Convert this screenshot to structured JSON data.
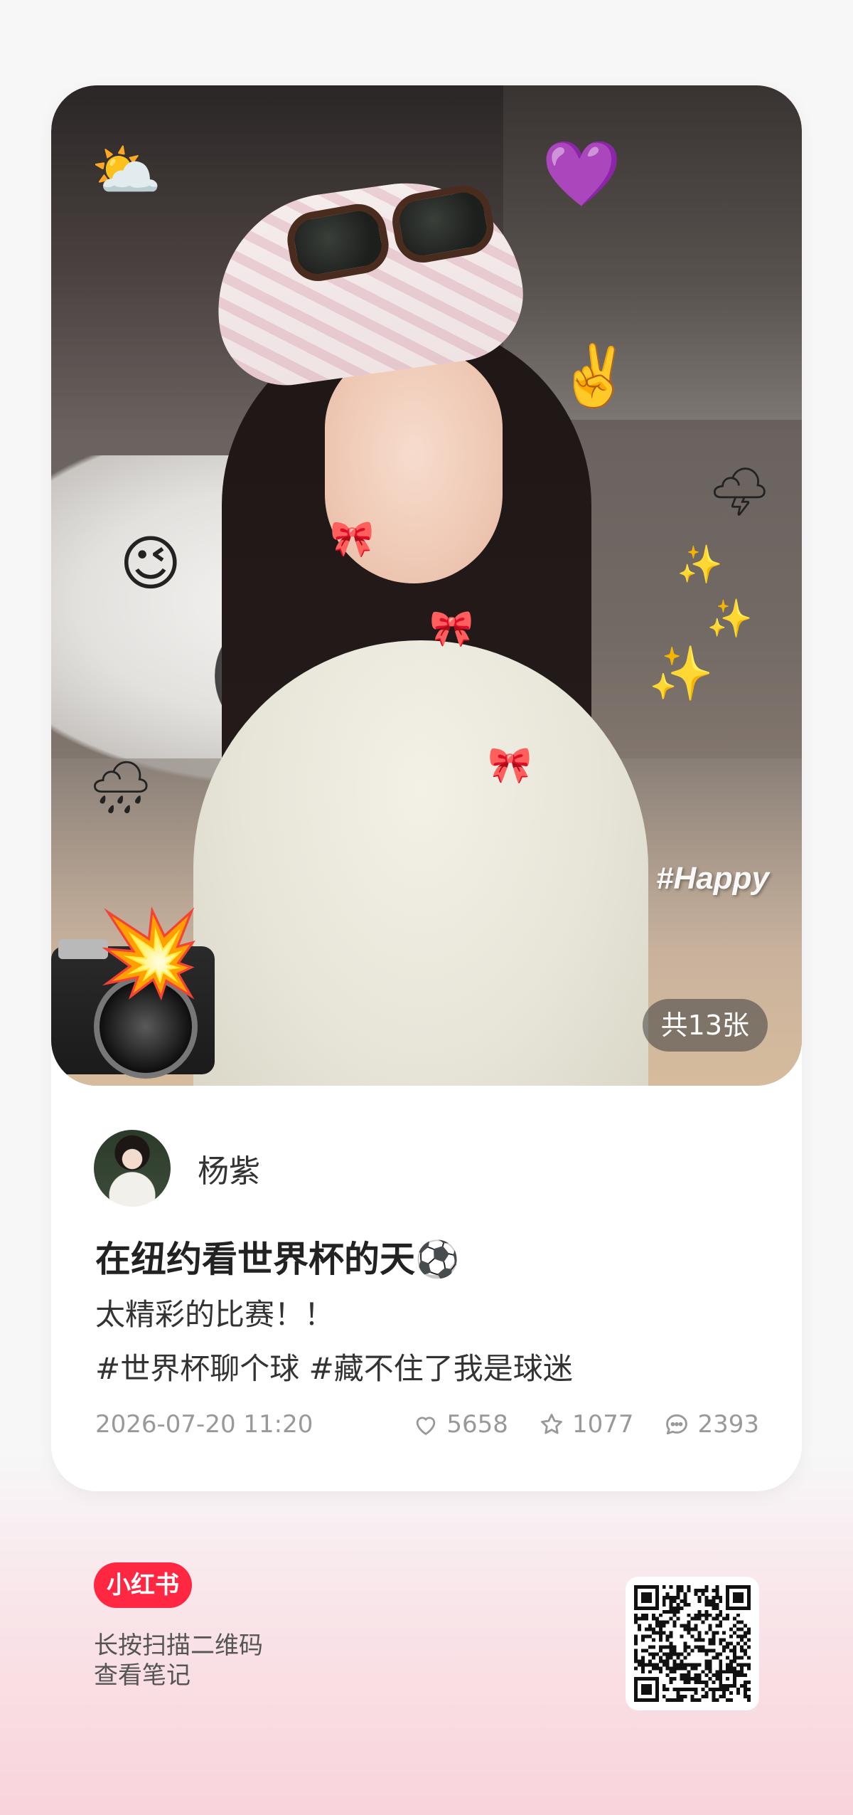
{
  "photo": {
    "hashtag_overlay": "#Happy",
    "image_count": "共13张",
    "stickers": [
      {
        "name": "sun-cloud-sticker",
        "glyph": "⛅"
      },
      {
        "name": "purple-hearts-sticker",
        "glyph": "💜"
      },
      {
        "name": "peace-hand-sticker",
        "glyph": "✌️"
      },
      {
        "name": "wink-face-sticker",
        "glyph": "😉"
      },
      {
        "name": "pink-bow-sticker",
        "glyph": "🎀"
      },
      {
        "name": "lightning-cloud-sticker",
        "glyph": "🌩"
      },
      {
        "name": "sparkles-sticker",
        "glyph": "✨"
      },
      {
        "name": "rain-cloud-sticker",
        "glyph": "🌧"
      },
      {
        "name": "explosion-sticker",
        "glyph": "💥"
      }
    ]
  },
  "author": {
    "name": "杨紫"
  },
  "note": {
    "title": "在纽约看世界杯的天⚽",
    "description": "太精彩的比赛！！",
    "tags": "#世界杯聊个球 #藏不住了我是球迷"
  },
  "meta": {
    "date": "2026-07-20 11:20",
    "likes": "5658",
    "collects": "1077",
    "comments": "2393"
  },
  "footer": {
    "brand": "小红书",
    "scan_hint_line1": "长按扫描二维码",
    "scan_hint_line2": "查看笔记"
  },
  "colors": {
    "brand": "#ff2742",
    "meta_text": "#999999"
  }
}
